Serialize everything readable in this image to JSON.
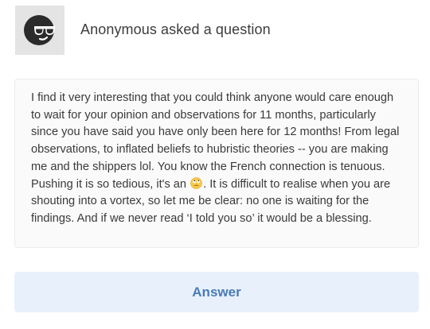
{
  "header": {
    "avatar_icon": "anonymous-sunglasses-avatar-icon",
    "asker_text": "Anonymous asked a question"
  },
  "question": {
    "text_part_1": "I find it very interesting that you could think anyone would care enough to wait for your opinion and observations for 11 months, particularly since you have said you have only been here for 12 months! From legal observations, to inflated beliefs to hubristic theories -- you are making me and the shippers lol. You know the French connection is tenuous. Pushing it is so tedious, it's an ",
    "emoji_icon": "eye-roll-emoji-icon",
    "text_part_2": ". It is difficult to realise when you are shouting into a vortex, so let me be clear: no one is waiting for the findings. And if we never read ‘I told you so’ it would be a blessing."
  },
  "actions": {
    "answer_label": "Answer"
  },
  "colors": {
    "answer_bg": "#e8f1fb",
    "answer_text": "#4a7bb7",
    "card_bg": "#fafafa",
    "avatar_bg": "#e4e4e4"
  }
}
